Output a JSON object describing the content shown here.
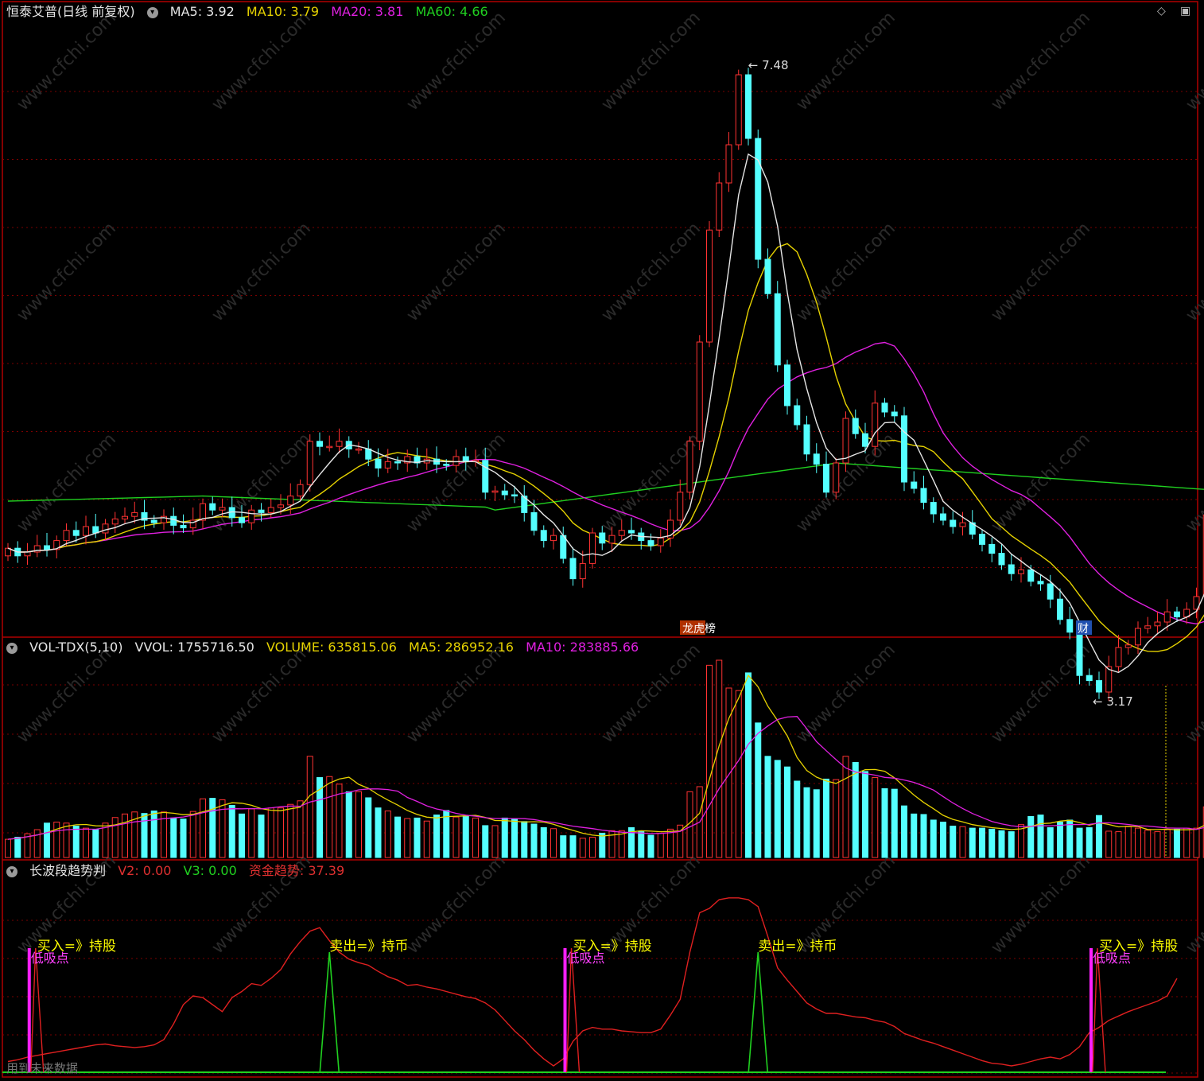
{
  "price_panel": {
    "title": "恒泰艾普(日线 前复权)",
    "ma_labels": [
      {
        "text": "MA5: 3.92",
        "color": "#e6e6e6"
      },
      {
        "text": "MA10: 3.79",
        "color": "#e6d200"
      },
      {
        "text": "MA20: 3.81",
        "color": "#e020e0"
      },
      {
        "text": "MA60: 4.66",
        "color": "#20d020"
      }
    ],
    "high_marker": "7.48",
    "low_marker": "3.17",
    "badge_left": "龙虎榜",
    "badge_right": "财"
  },
  "volume_panel": {
    "labels": [
      {
        "text": "VOL-TDX(5,10)",
        "color": "#e6e6e6"
      },
      {
        "text": "VVOL: 1755716.50",
        "color": "#e6e6e6"
      },
      {
        "text": "VOLUME: 635815.06",
        "color": "#e6d200"
      },
      {
        "text": "MA5: 286952.16",
        "color": "#e6d200"
      },
      {
        "text": "MA10: 283885.66",
        "color": "#e020e0"
      }
    ]
  },
  "indicator_panel": {
    "labels": [
      {
        "text": "长波段趋势判",
        "color": "#e6e6e6"
      },
      {
        "text": "V2: 0.00",
        "color": "#e03030"
      },
      {
        "text": "V3: 0.00",
        "color": "#20d020"
      },
      {
        "text": "资金趋势: 37.39",
        "color": "#e03030"
      }
    ],
    "signals": [
      {
        "text": "买入=》持股",
        "sub": "低吸点",
        "type": "buy",
        "day": 3
      },
      {
        "text": "卖出=》持币",
        "sub": "",
        "type": "sell",
        "day": 33
      },
      {
        "text": "买入=》持股",
        "sub": "低吸点",
        "type": "buy",
        "day": 58
      },
      {
        "text": "卖出=》持币",
        "sub": "",
        "type": "sell",
        "day": 77
      },
      {
        "text": "买入=》持股",
        "sub": "低吸点",
        "type": "buy",
        "day": 112
      }
    ],
    "footer": "用到未来数据"
  },
  "watermark": "www.cfchi.com",
  "colors": {
    "up": "#ff3232",
    "down": "#54ffff",
    "ma5": "#e6e6e6",
    "ma10": "#e6d200",
    "ma20": "#e020e0",
    "ma60": "#20d020",
    "grid": "#7a0000",
    "border": "#b00000"
  },
  "chart_data": {
    "type": "candlestick",
    "price_range": [
      3.0,
      7.8
    ],
    "closes": [
      3.68,
      3.62,
      3.65,
      3.7,
      3.67,
      3.74,
      3.82,
      3.78,
      3.85,
      3.8,
      3.87,
      3.91,
      3.93,
      3.96,
      3.9,
      3.88,
      3.93,
      3.86,
      3.84,
      3.9,
      4.03,
      3.98,
      4.0,
      3.92,
      3.88,
      3.98,
      3.96,
      4.0,
      4.02,
      4.09,
      4.18,
      4.52,
      4.48,
      4.48,
      4.52,
      4.46,
      4.46,
      4.38,
      4.31,
      4.36,
      4.35,
      4.4,
      4.35,
      4.38,
      4.34,
      4.33,
      4.4,
      4.36,
      4.37,
      4.12,
      4.13,
      4.1,
      4.09,
      3.96,
      3.82,
      3.74,
      3.78,
      3.6,
      3.44,
      3.56,
      3.8,
      3.72,
      3.78,
      3.82,
      3.8,
      3.74,
      3.7,
      3.76,
      3.9,
      4.12,
      4.52,
      5.3,
      6.18,
      6.55,
      6.85,
      7.4,
      6.9,
      5.95,
      5.68,
      5.12,
      4.8,
      4.65,
      4.42,
      4.34,
      4.12,
      4.35,
      4.7,
      4.58,
      4.48,
      4.82,
      4.75,
      4.72,
      4.2,
      4.15,
      4.04,
      3.95,
      3.9,
      3.85,
      3.88,
      3.79,
      3.71,
      3.64,
      3.55,
      3.48,
      3.51,
      3.42,
      3.4,
      3.28,
      3.12,
      3.02,
      2.68,
      2.64,
      2.55,
      2.75,
      2.9,
      2.92,
      3.05,
      3.07,
      3.1,
      3.18,
      3.14,
      3.2,
      3.3,
      3.94
    ],
    "volumes": [
      36,
      40,
      47,
      55,
      68,
      70,
      68,
      62,
      58,
      55,
      68,
      79,
      86,
      90,
      87,
      92,
      90,
      78,
      76,
      91,
      116,
      117,
      114,
      103,
      86,
      96,
      84,
      98,
      98,
      105,
      112,
      200,
      158,
      160,
      145,
      130,
      130,
      118,
      98,
      92,
      80,
      77,
      78,
      72,
      84,
      93,
      80,
      82,
      78,
      63,
      63,
      78,
      76,
      71,
      66,
      59,
      57,
      43,
      43,
      38,
      40,
      48,
      53,
      53,
      59,
      51,
      44,
      48,
      56,
      64,
      130,
      140,
      380,
      390,
      335,
      330,
      365,
      266,
      200,
      192,
      179,
      151,
      138,
      134,
      155,
      154,
      200,
      188,
      170,
      158,
      136,
      135,
      102,
      86,
      85,
      74,
      70,
      62,
      61,
      58,
      58,
      56,
      53,
      51,
      65,
      81,
      84,
      59,
      70,
      74,
      58,
      59,
      83,
      52,
      51,
      62,
      58,
      54,
      51,
      55,
      56,
      58,
      58,
      100
    ],
    "fund_trend": [
      5,
      7,
      10,
      12,
      14,
      16,
      18,
      20,
      22,
      24,
      25,
      23,
      22,
      21,
      22,
      24,
      30,
      48,
      70,
      80,
      78,
      70,
      62,
      78,
      85,
      94,
      92,
      100,
      110,
      128,
      142,
      154,
      158,
      143,
      130,
      122,
      118,
      115,
      108,
      102,
      98,
      92,
      93,
      90,
      88,
      85,
      82,
      79,
      77,
      72,
      64,
      52,
      40,
      30,
      18,
      8,
      0,
      8,
      28,
      40,
      44,
      42,
      42,
      40,
      39,
      38,
      38,
      42,
      58,
      76,
      130,
      175,
      180,
      190,
      192,
      192,
      190,
      182,
      148,
      112,
      98,
      85,
      72,
      65,
      60,
      60,
      58,
      56,
      55,
      52,
      50,
      45,
      37,
      33,
      29,
      26,
      22,
      18,
      14,
      10,
      6,
      3,
      2,
      0,
      2,
      5,
      8,
      10,
      8,
      13,
      22,
      38,
      44,
      52,
      57,
      62,
      66,
      70,
      74,
      80,
      100
    ]
  }
}
